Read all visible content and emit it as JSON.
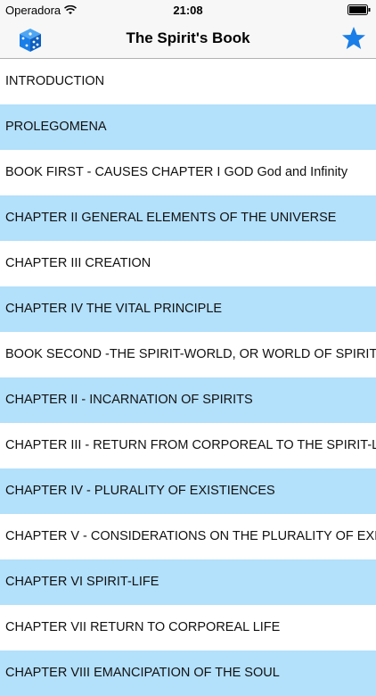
{
  "status_bar": {
    "carrier": "Operadora",
    "time": "21:08"
  },
  "nav": {
    "title": "The Spirit's Book",
    "left_icon": "dice-icon",
    "right_icon": "star-icon",
    "accent_color": "#1a7ee8"
  },
  "colors": {
    "alt_row": "#b3e0fb",
    "row": "#ffffff"
  },
  "chapters": [
    {
      "label": "INTRODUCTION"
    },
    {
      "label": "PROLEGOMENA"
    },
    {
      "label": "BOOK FIRST - CAUSES CHAPTER I GOD God and Infinity"
    },
    {
      "label": "CHAPTER II GENERAL ELEMENTS OF THE UNIVERSE"
    },
    {
      "label": "CHAPTER III CREATION"
    },
    {
      "label": "CHAPTER IV THE VITAL PRINCIPLE"
    },
    {
      "label": "BOOK SECOND -THE SPIRIT-WORLD, OR WORLD OF SPIRITS"
    },
    {
      "label": "CHAPTER II - INCARNATION OF SPIRITS"
    },
    {
      "label": "CHAPTER III - RETURN FROM CORPOREAL TO THE SPIRIT-LIFE"
    },
    {
      "label": "CHAPTER IV - PLURALITY OF EXISTIENCES"
    },
    {
      "label": "CHAPTER V - CONSIDERATIONS ON THE PLURALITY OF EXISTENCES"
    },
    {
      "label": "CHAPTER VI SPIRIT-LIFE"
    },
    {
      "label": "CHAPTER VII RETURN TO CORPOREAL LIFE"
    },
    {
      "label": "CHAPTER VIII EMANCIPATION OF THE SOUL"
    }
  ]
}
